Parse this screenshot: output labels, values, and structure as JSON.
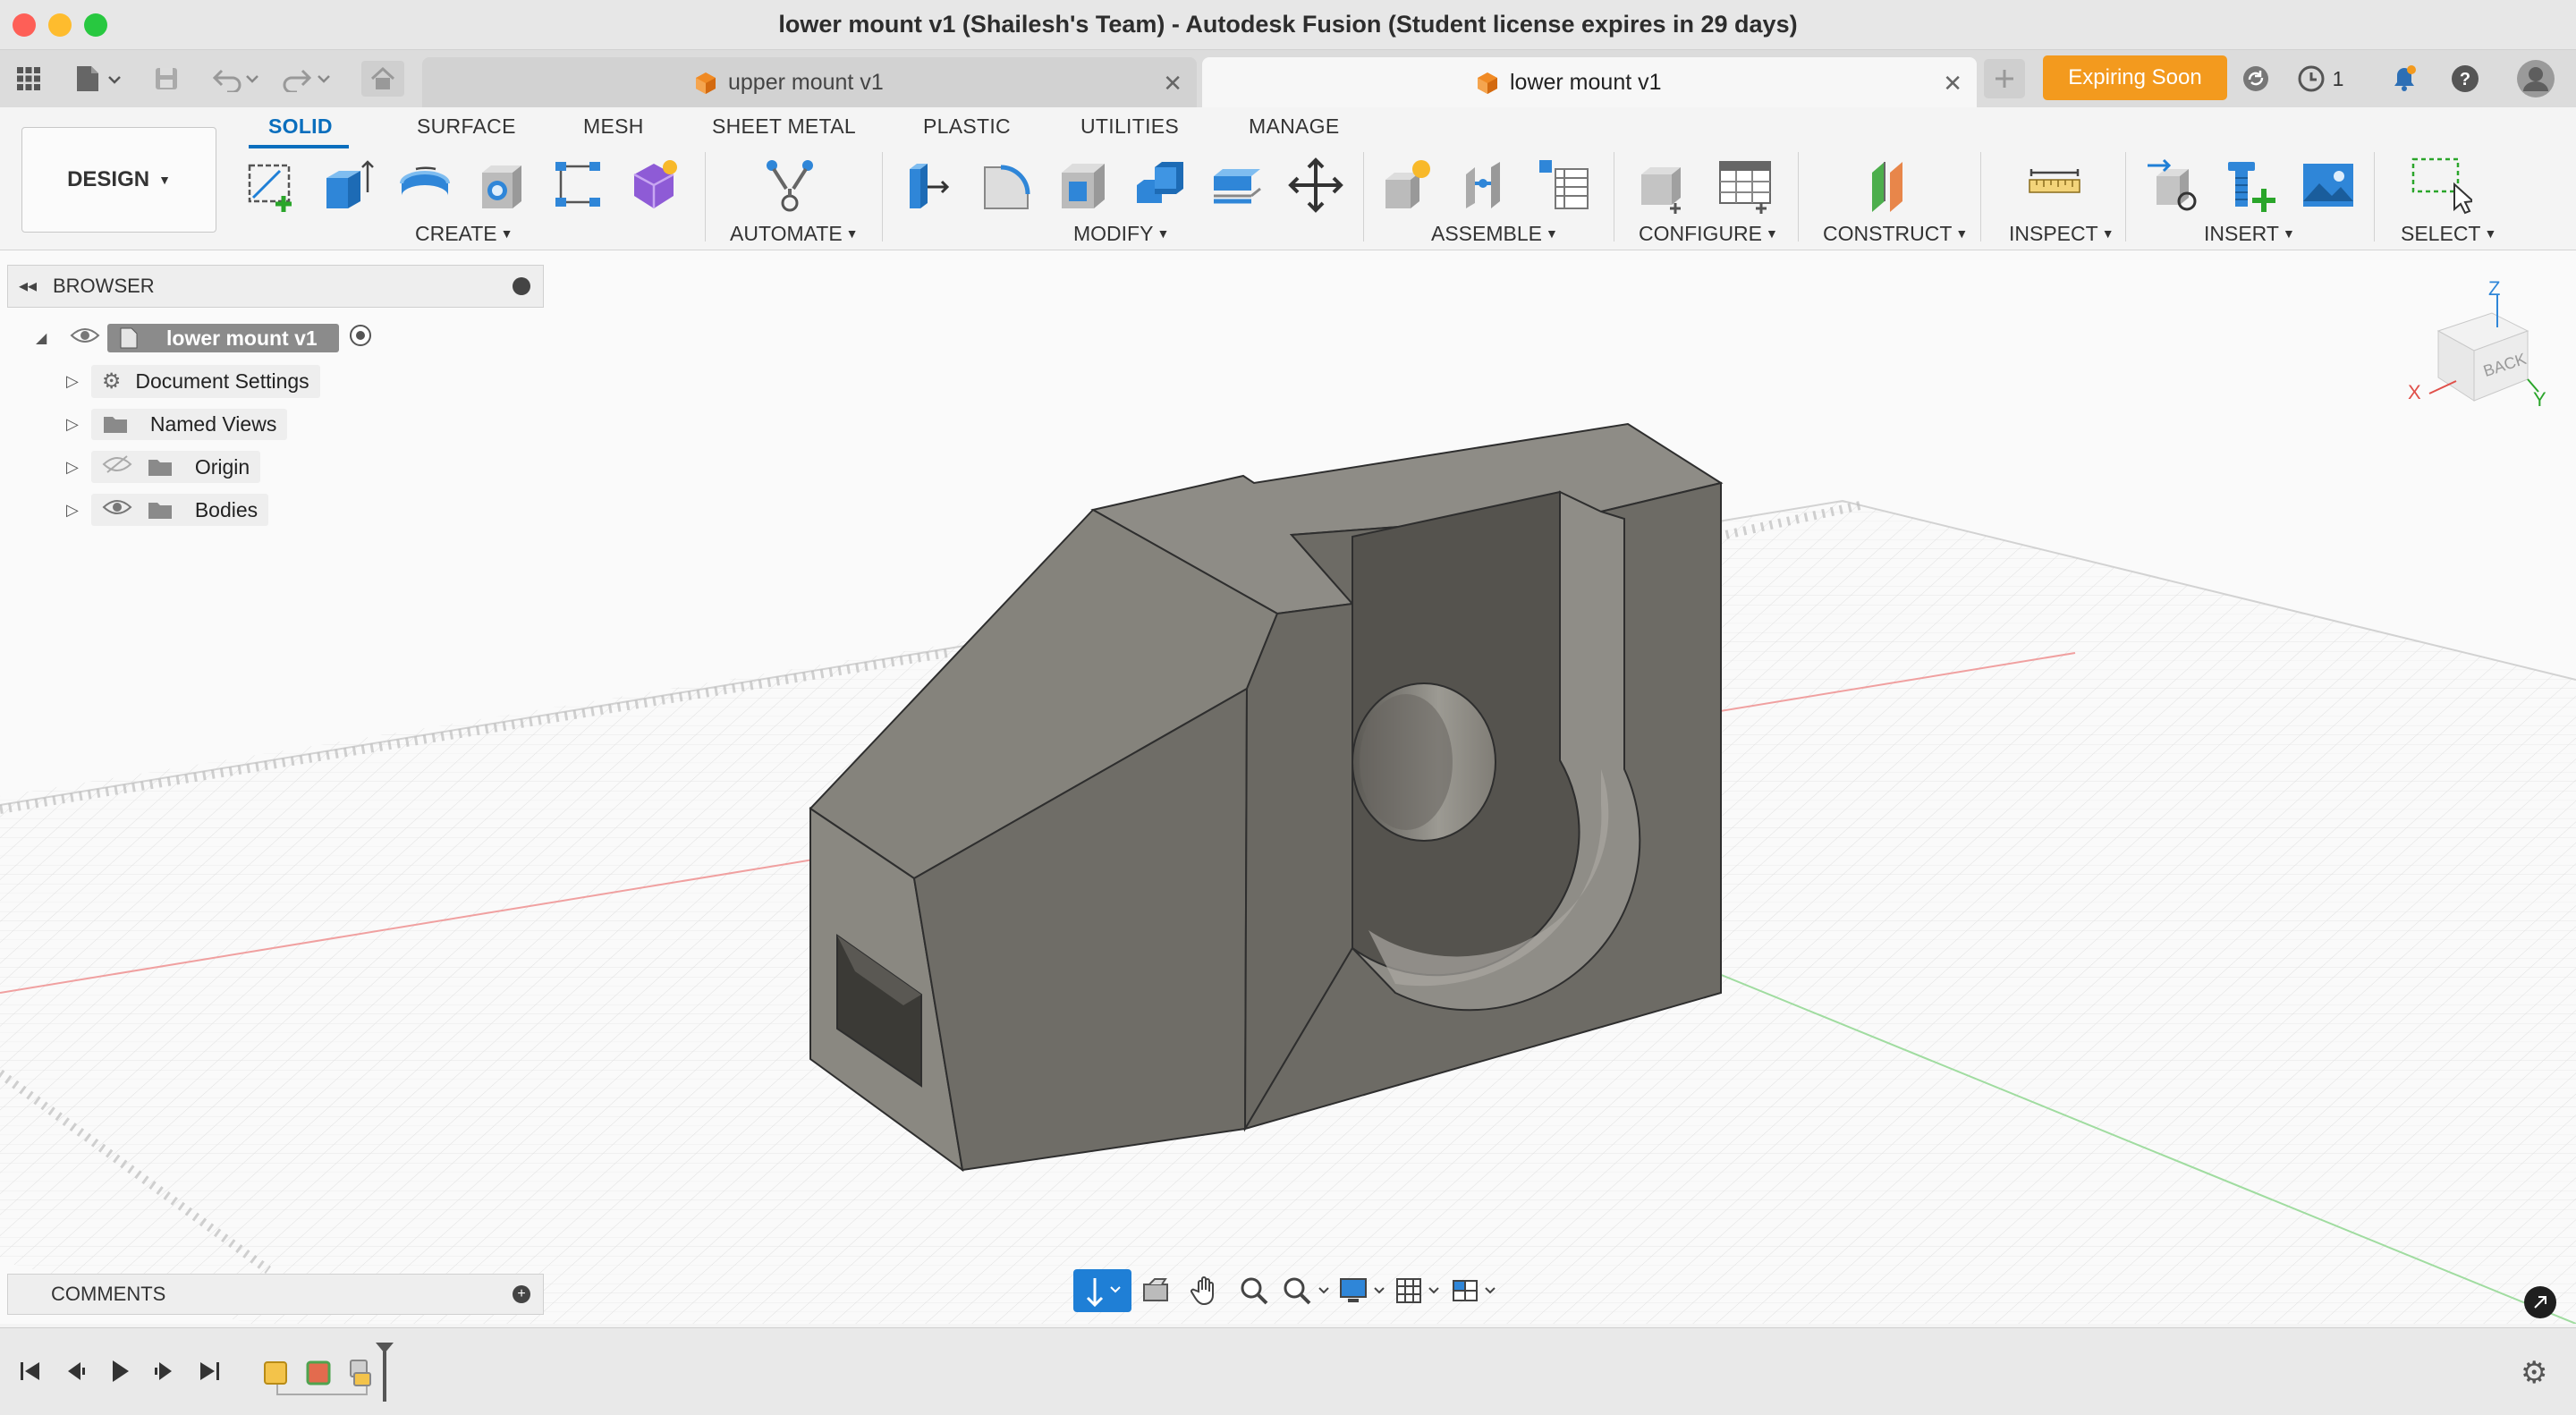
{
  "window": {
    "title": "lower mount v1 (Shailesh's Team) - Autodesk Fusion (Student license expires in 29 days)"
  },
  "tabs": [
    {
      "label": "upper mount v1",
      "active": false
    },
    {
      "label": "lower mount v1",
      "active": true
    }
  ],
  "header": {
    "expiring_label": "Expiring Soon",
    "job_count": "1"
  },
  "workspace": {
    "label": "DESIGN"
  },
  "ribbon_tabs": [
    "SOLID",
    "SURFACE",
    "MESH",
    "SHEET METAL",
    "PLASTIC",
    "UTILITIES",
    "MANAGE"
  ],
  "ribbon_groups": [
    "CREATE",
    "AUTOMATE",
    "MODIFY",
    "ASSEMBLE",
    "CONFIGURE",
    "CONSTRUCT",
    "INSPECT",
    "INSERT",
    "SELECT"
  ],
  "browser": {
    "title": "BROWSER",
    "root": "lower mount v1",
    "items": [
      "Document Settings",
      "Named Views",
      "Origin",
      "Bodies"
    ]
  },
  "comments": {
    "title": "COMMENTS"
  },
  "viewcube": {
    "face": "BACK",
    "axes": [
      "Z",
      "X",
      "Y"
    ]
  },
  "colors": {
    "accent": "#0a6ebd",
    "expiring": "#f39a1e",
    "model": "#77746e",
    "axis_red": "#f0a0a0",
    "axis_green": "#a0dca0"
  },
  "icons": {
    "apps": "grid-icon",
    "file": "file-icon",
    "save": "save-icon",
    "undo": "undo-icon",
    "redo": "redo-icon",
    "home": "home-icon",
    "new_tab": "plus-icon",
    "sync": "sync-icon",
    "jobs": "clock-icon",
    "notifications": "bell-icon",
    "help": "help-icon",
    "account": "avatar-icon"
  }
}
